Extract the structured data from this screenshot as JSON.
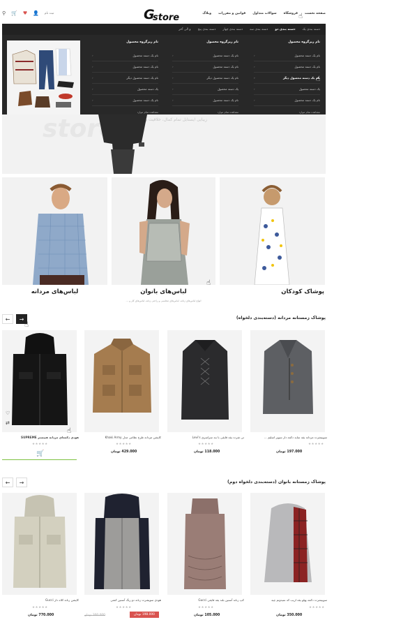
{
  "header": {
    "logo_text": "store",
    "logo_letter": "G",
    "nav": [
      "صفحه نخست",
      "فروشگاه",
      "سوالات متداول",
      "قوانین و مقررات",
      "وبلاگ"
    ],
    "login_label": "ثبت نام"
  },
  "mega_menu": {
    "tabs": [
      "دسته بندی یک",
      "دسته بندی دو",
      "دسته بندی سه",
      "دسته بندی چهار",
      "دسته بندی پنج",
      "و الی آخر"
    ],
    "columns": [
      {
        "title": "نام زیرگروه محصول",
        "links": [
          "نام یک دسته محصول",
          "نام یک دسته محصول",
          "نام یک دسته محصول دیگر",
          "یک دسته محصول",
          "نام یک دسته محصول"
        ],
        "view_all": "مشاهده تمام موارد"
      },
      {
        "title": "نام زیرگروه محصول",
        "links": [
          "نام یک دسته محصول",
          "نام یک دسته محصول",
          "نام یک دسته محصول دیگر",
          "یک دسته محصول",
          "نام یک دسته محصول"
        ],
        "view_all": "مشاهده تمام موارد"
      },
      {
        "title": "نام زیرگروه محصول",
        "links": [
          "نام یک دسته محصول",
          "نام یک دسته محصول",
          "نام یک دسته محصول دیگر",
          "یک دسته محصول",
          "نام یک دسته محصول"
        ],
        "view_all": "مشاهده تمام موارد"
      }
    ]
  },
  "hero": {
    "ghost_text": "store",
    "caption": "زیبایی ایستایل تمام کمال، خلاقیت و کیفیت برتر"
  },
  "categories": [
    {
      "label": "پوشاک کودکان"
    },
    {
      "label": "لباس‌های بانوان",
      "subtitle": "انواع لباس‌های زنانه، لباس‌های مجلسی و راحتی زنانه، لباس‌های کار و ..."
    },
    {
      "label": "لباس‌های مردانه"
    }
  ],
  "section_men": {
    "title": "پوشاک زمستانه مردانه (دسته‌بندی دلخواه)",
    "products": [
      {
        "name": "سوییشرت مردانه یقه ساید دکمه دار سوپر اسلیم ...",
        "price": "197.000 تومان",
        "stars": "★★★★★"
      },
      {
        "name": "تی شرت یقه قایقی با بند سراسری Levi's",
        "price": "118.000 تومان",
        "stars": "★★★★★"
      },
      {
        "name": "کاپشن مردانه طرح نظامی مدل Khaki Army",
        "price": "429.000 تومان",
        "stars": "★★★★★"
      },
      {
        "name": "هودی دکمه‌ای مردانه هیپستر SUPREME",
        "price": "",
        "stars": "★★★★★"
      }
    ]
  },
  "section_women": {
    "title": "پوشاک زمستانه بانوان (دسته‌بندی دلخواه دوم)",
    "products": [
      {
        "name": "سوییشرت دکمه پهلو یقه اریب که نمیدونم چیه",
        "price": "350.000 تومان",
        "stars": "★★★★★"
      },
      {
        "name": "کپ زنانه آستین بلند یقه قایقی Gucci",
        "price": "105.000 تومان",
        "stars": "★★★★★"
      },
      {
        "name": "هودی سویشرت زنانه دو رنگ آستین کشی",
        "price": "",
        "old_price": "300.000 تومان",
        "sale_price": "198.000 تومان",
        "stars": "★★★★★"
      },
      {
        "name": "کاپشن زنانه کلاه دار Gucci",
        "price": "770.000 تومان",
        "stars": "★★★★★"
      }
    ]
  },
  "colors": {
    "dark": "#282828",
    "accent": "#7dc142",
    "sale": "#d9534f"
  }
}
